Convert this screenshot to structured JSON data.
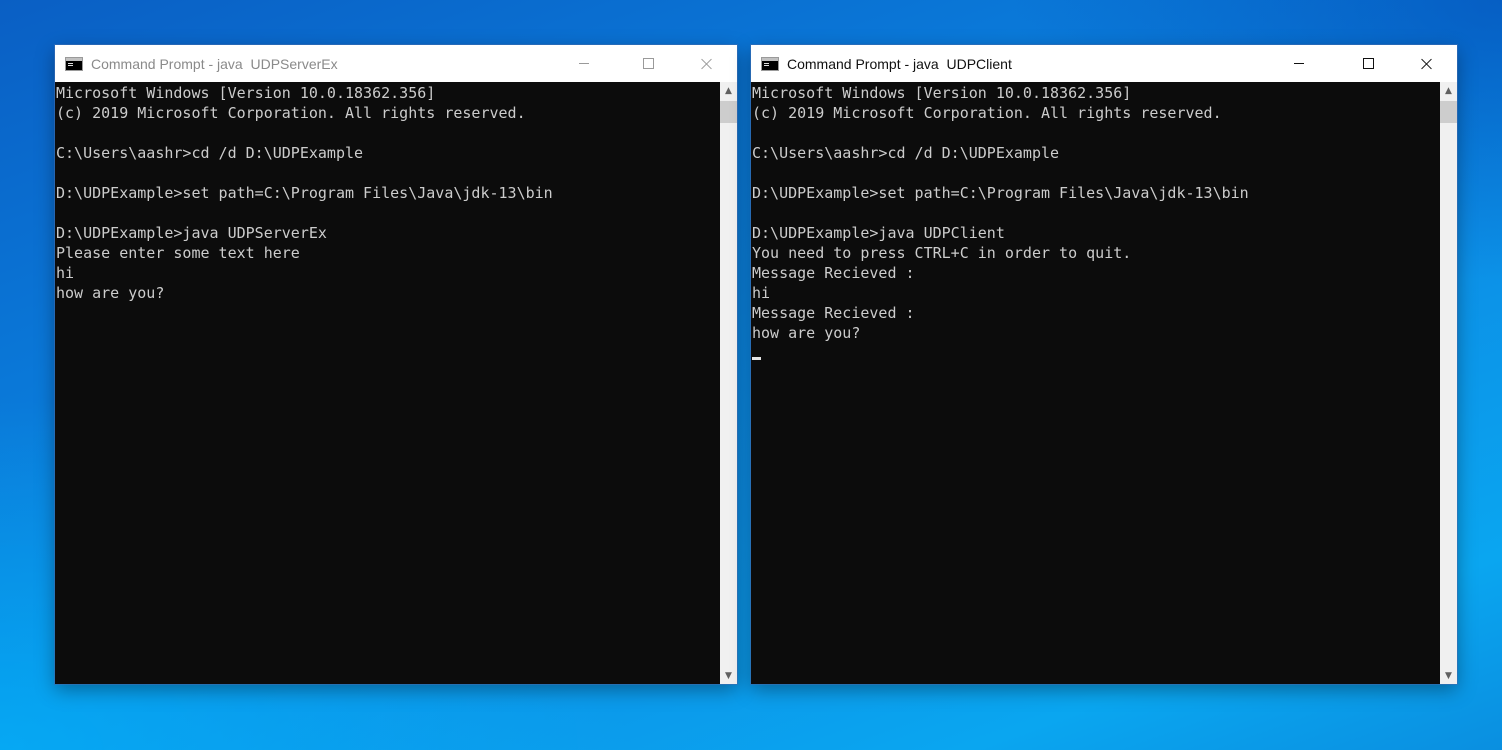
{
  "windows": {
    "server": {
      "title": "Command Prompt - java  UDPServerEx",
      "lines": [
        "Microsoft Windows [Version 10.0.18362.356]",
        "(c) 2019 Microsoft Corporation. All rights reserved.",
        "",
        "C:\\Users\\aashr>cd /d D:\\UDPExample",
        "",
        "D:\\UDPExample>set path=C:\\Program Files\\Java\\jdk-13\\bin",
        "",
        "D:\\UDPExample>java UDPServerEx",
        "Please enter some text here",
        "hi",
        "how are you?"
      ]
    },
    "client": {
      "title": "Command Prompt - java  UDPClient",
      "lines": [
        "Microsoft Windows [Version 10.0.18362.356]",
        "(c) 2019 Microsoft Corporation. All rights reserved.",
        "",
        "C:\\Users\\aashr>cd /d D:\\UDPExample",
        "",
        "D:\\UDPExample>set path=C:\\Program Files\\Java\\jdk-13\\bin",
        "",
        "D:\\UDPExample>java UDPClient",
        "You need to press CTRL+C in order to quit.",
        "Message Recieved :",
        "hi",
        "Message Recieved :",
        "how are you?"
      ]
    }
  },
  "icons": {
    "app": "command-prompt-icon",
    "minimize": "minimize-icon",
    "maximize": "maximize-icon",
    "close": "close-icon",
    "scroll_up": "scroll-up-arrow-icon",
    "scroll_down": "scroll-down-arrow-icon"
  },
  "colors": {
    "console_bg": "#0c0c0c",
    "console_text": "#cccccc",
    "titlebar_bg": "#ffffff",
    "inactive_title": "#8a8a8a",
    "active_title": "#111111"
  }
}
